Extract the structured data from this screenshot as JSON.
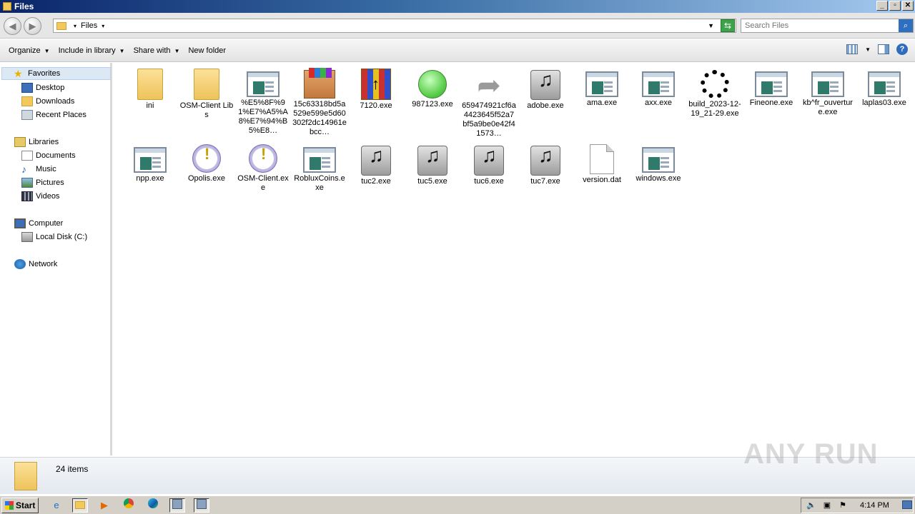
{
  "window": {
    "title": "Files",
    "min": "_",
    "max": "▫",
    "close": "✕"
  },
  "address": {
    "crumb": "Files",
    "search_placeholder": "Search Files"
  },
  "commands": {
    "organize": "Organize",
    "include": "Include in library",
    "share": "Share with",
    "new_folder": "New folder"
  },
  "nav": {
    "favorites": "Favorites",
    "desktop": "Desktop",
    "downloads": "Downloads",
    "recent": "Recent Places",
    "libraries": "Libraries",
    "documents": "Documents",
    "music": "Music",
    "pictures": "Pictures",
    "videos": "Videos",
    "computer": "Computer",
    "localdisk": "Local Disk (C:)",
    "network": "Network"
  },
  "files": [
    {
      "name": "ini",
      "icon": "folder-icon"
    },
    {
      "name": "OSM-Client Libs",
      "icon": "folder-icon"
    },
    {
      "name": "%E5%8F%91%E7%A5%A8%E7%94%B5%E8…",
      "icon": "application-icon"
    },
    {
      "name": "15c63318bd5a529e599e5d60302f2dc14961ebcc…",
      "icon": "winrar-icon"
    },
    {
      "name": "7120.exe",
      "icon": "installer-icon"
    },
    {
      "name": "987123.exe",
      "icon": "green-orb-icon"
    },
    {
      "name": "659474921cf6a4423645f52a7bf5a9be0e42f41573…",
      "icon": "shortcut-arrow-icon"
    },
    {
      "name": "adobe.exe",
      "icon": "music-icon"
    },
    {
      "name": "ama.exe",
      "icon": "application-icon"
    },
    {
      "name": "axx.exe",
      "icon": "application-icon"
    },
    {
      "name": "build_2023-12-19_21-29.exe",
      "icon": "spinner-icon"
    },
    {
      "name": "Fineone.exe",
      "icon": "application-icon"
    },
    {
      "name": "kb^fr_ouverture.exe",
      "icon": "application-icon"
    },
    {
      "name": "laplas03.exe",
      "icon": "application-icon"
    },
    {
      "name": "npp.exe",
      "icon": "application-icon"
    },
    {
      "name": "Opolis.exe",
      "icon": "warning-icon"
    },
    {
      "name": "OSM-Client.exe",
      "icon": "warning-icon"
    },
    {
      "name": "RobluxCoins.exe",
      "icon": "application-icon"
    },
    {
      "name": "tuc2.exe",
      "icon": "music-icon"
    },
    {
      "name": "tuc5.exe",
      "icon": "music-icon"
    },
    {
      "name": "tuc6.exe",
      "icon": "music-icon"
    },
    {
      "name": "tuc7.exe",
      "icon": "music-icon"
    },
    {
      "name": "version.dat",
      "icon": "document-icon"
    },
    {
      "name": "windows.exe",
      "icon": "application-icon"
    }
  ],
  "status": {
    "count": "24 items"
  },
  "watermark": "ANY RUN",
  "taskbar": {
    "start": "Start",
    "clock": "4:14 PM"
  }
}
